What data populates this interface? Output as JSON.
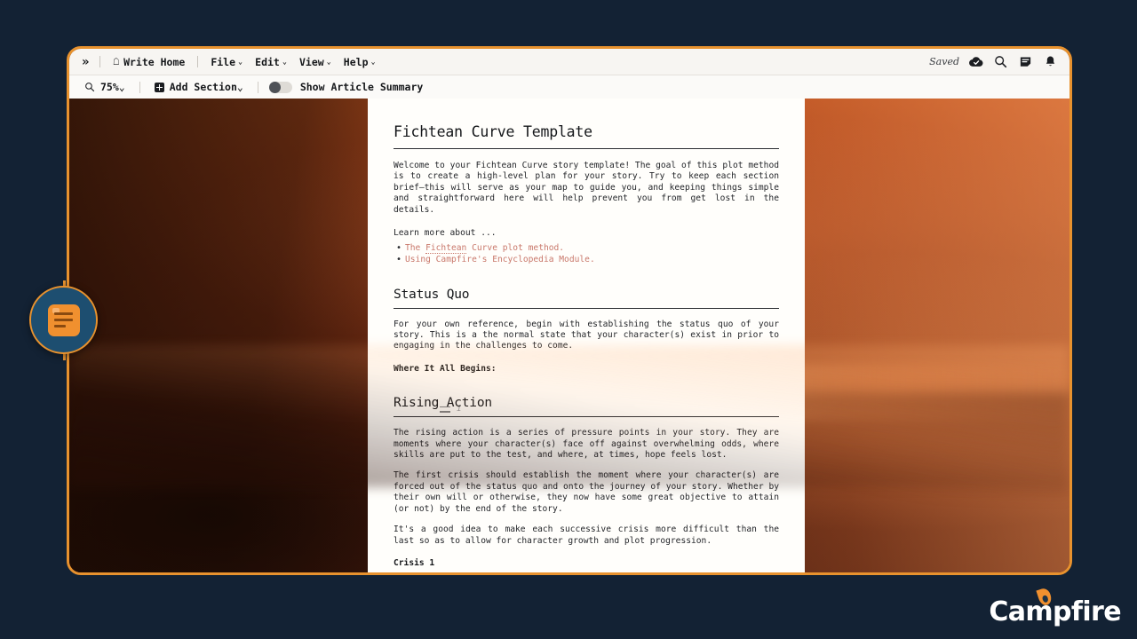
{
  "window": {
    "border_color": "#e8922e",
    "page_background": "#132234"
  },
  "menubar": {
    "expand_icon": "»",
    "home_label": "Write Home",
    "items": [
      {
        "label": "File",
        "caret": "⌄"
      },
      {
        "label": "Edit",
        "caret": "⌄"
      },
      {
        "label": "View",
        "caret": "⌄"
      },
      {
        "label": "Help",
        "caret": "⌄"
      }
    ],
    "status_label": "Saved",
    "right_icons": [
      {
        "name": "cloud-check-icon"
      },
      {
        "name": "search-icon"
      },
      {
        "name": "notes-icon"
      },
      {
        "name": "bell-icon"
      }
    ]
  },
  "toolbar": {
    "zoom_level": "75%",
    "zoom_caret": "⌄",
    "add_section_label": "Add Section",
    "add_section_caret": "⌄",
    "toggle_label": "Show Article Summary",
    "toggle_state": "off"
  },
  "document": {
    "title": "Fichtean Curve Template",
    "intro": "Welcome to your Fichtean Curve story template! The goal of this plot method is to create a high-level plan for your story. Try to keep each section brief—this will serve as your map to guide you, and keeping things simple and straightforward here will help prevent you from get lost in the details.",
    "learn_more_label": "Learn more about ...",
    "links": [
      {
        "prefix": "The ",
        "spell": "Fichtean",
        "suffix": " Curve plot method."
      },
      {
        "prefix": "Using ",
        "spell": "Campfire's",
        "suffix": " Encyclopedia Module."
      }
    ],
    "link_color": "#c9786b",
    "sections": [
      {
        "heading": "Status Quo",
        "paragraphs": [
          "For your own reference, begin with establishing the status quo of your story. This is a the normal state that your character(s) exist in prior to engaging in the challenges to come."
        ],
        "prompt": "Where It All Begins:"
      },
      {
        "heading": "Rising Action",
        "paragraphs": [
          "The rising action is a series of pressure points in your story. They are moments where your character(s) face off against overwhelming odds, where skills are put to the test, and where, at times, hope feels lost.",
          "The first crisis should establish the moment where your character(s) are forced out of the status quo and onto the journey of your story. Whether by their own will or otherwise, they now have some great objective to attain (or not) by the end of the story.",
          "It's a good idea to make each successive crisis more difficult than the last so as to allow for character growth and plot progression."
        ],
        "prompt": "Crisis 1"
      }
    ],
    "drag_handle_hint": "i"
  },
  "fab": {
    "name": "article-panel-button"
  },
  "brand": {
    "name": "Campfire"
  }
}
